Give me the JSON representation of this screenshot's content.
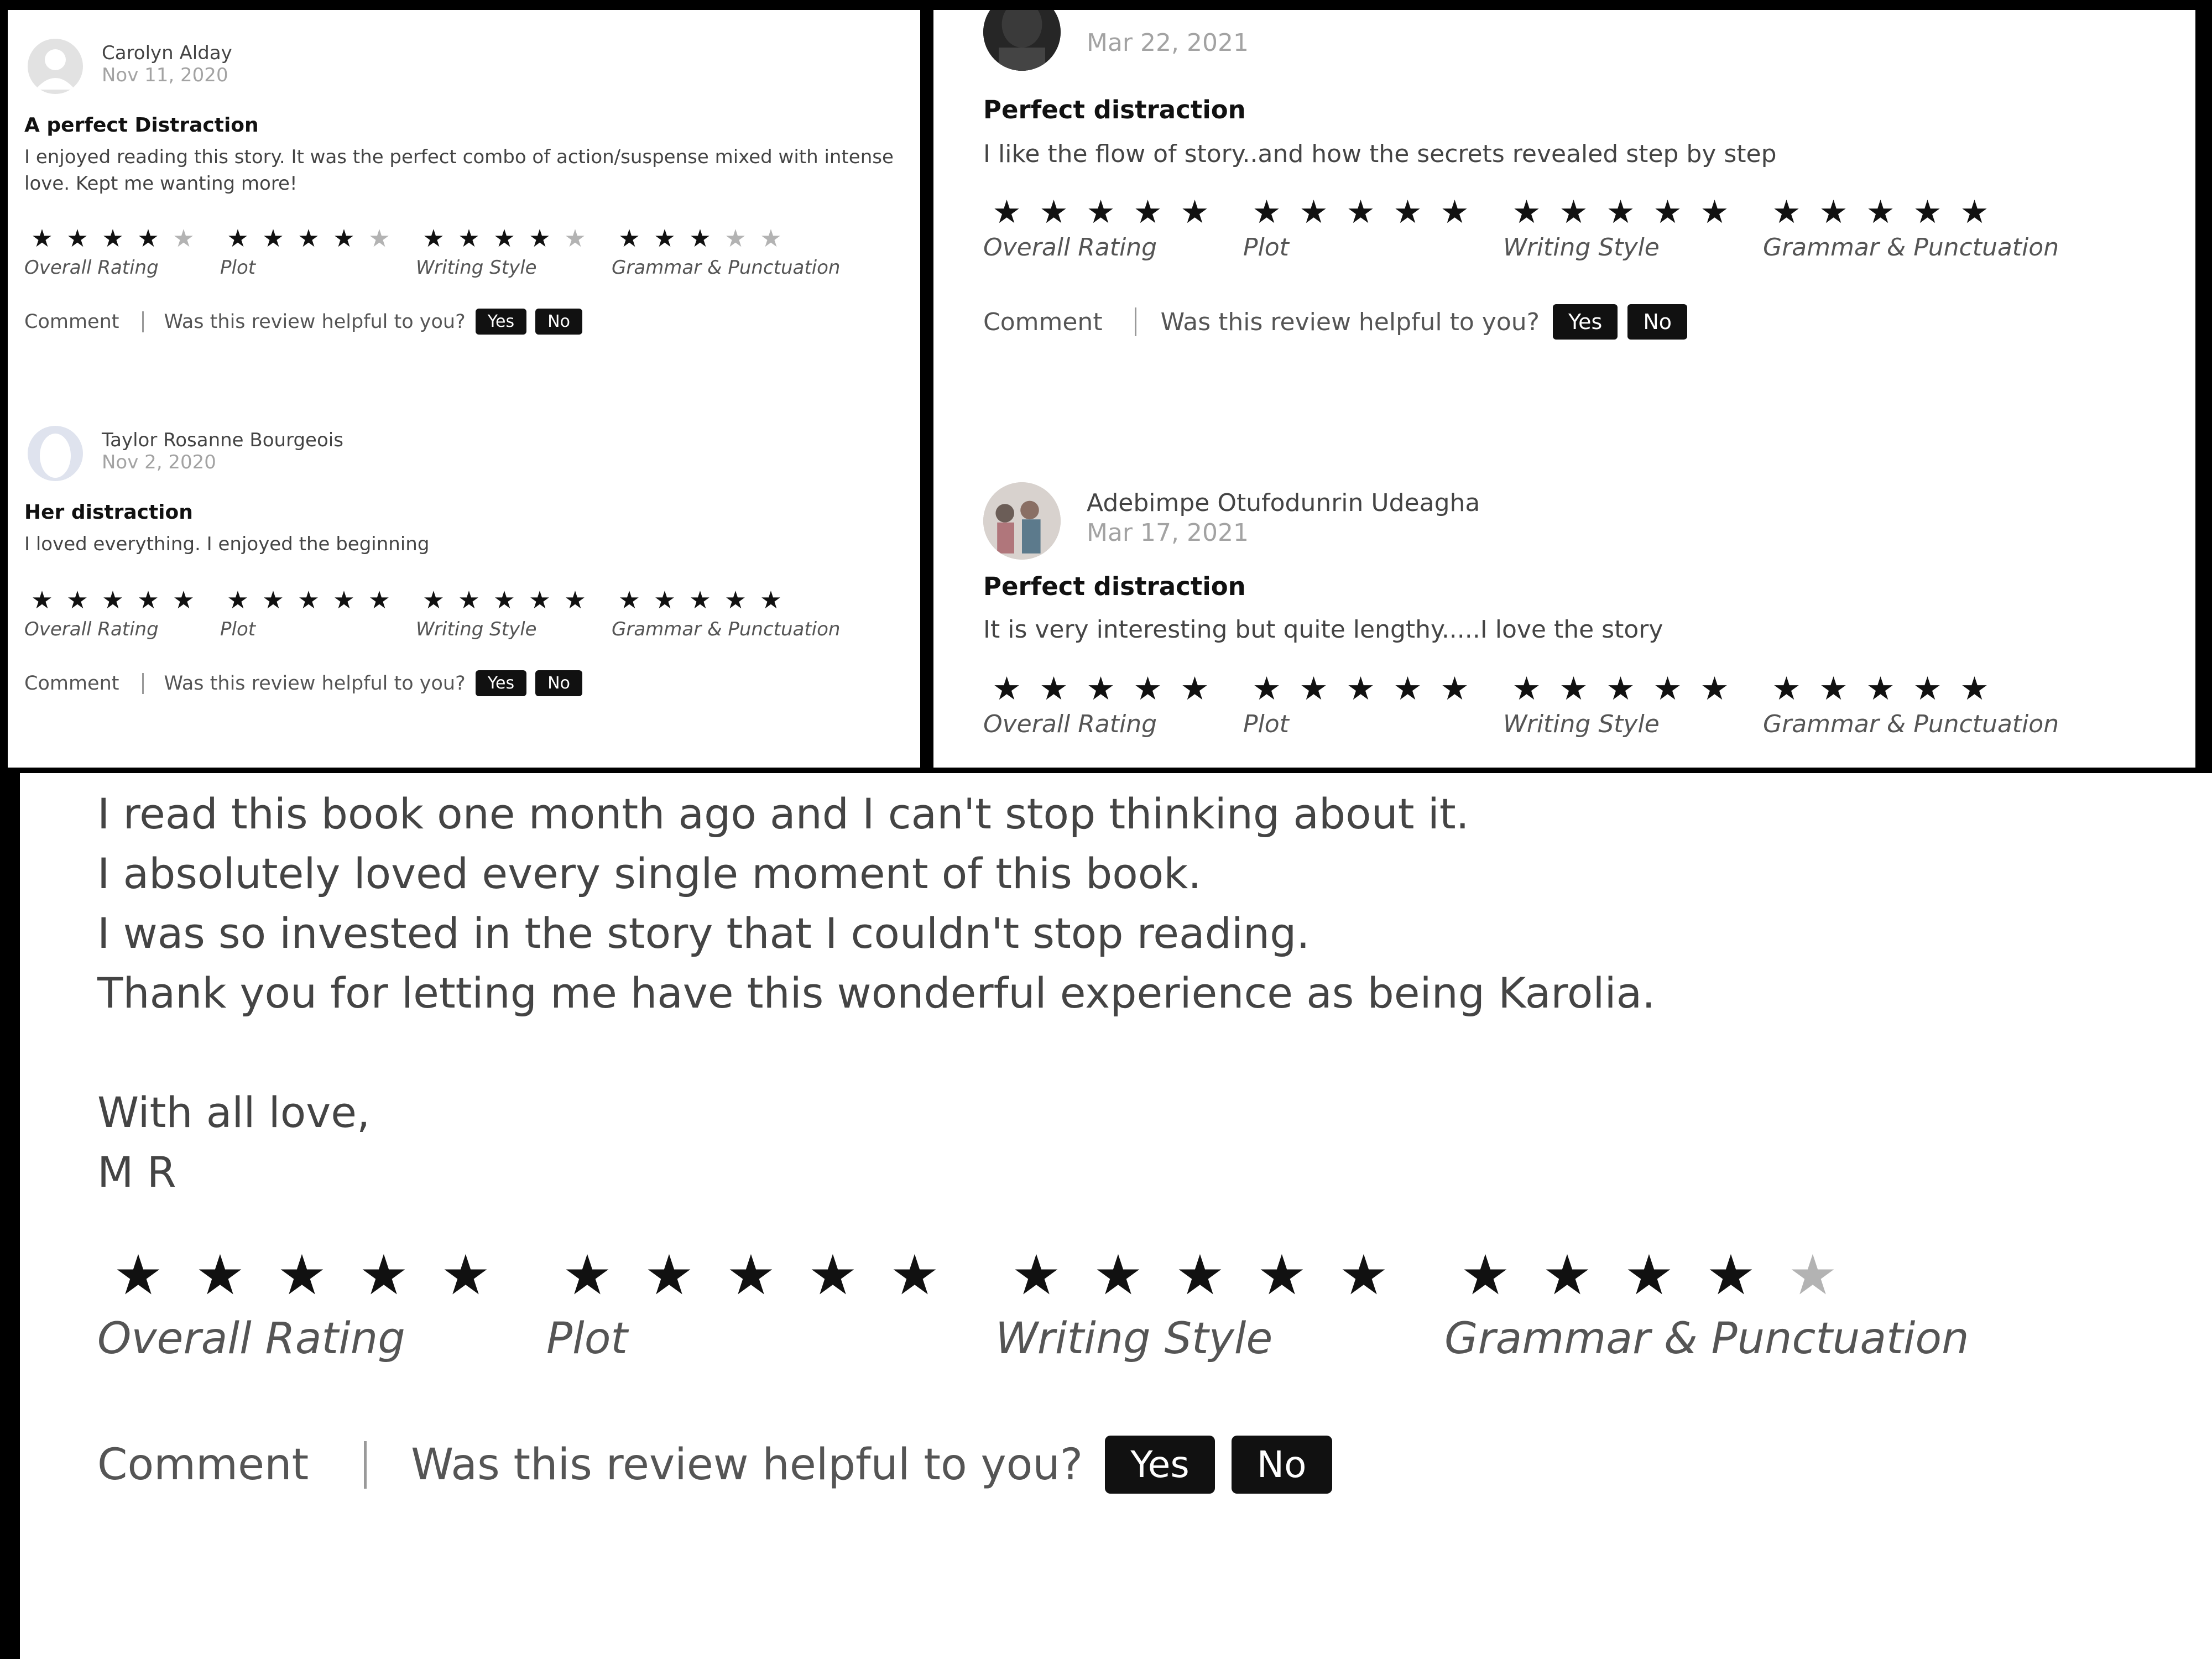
{
  "panel_left": {
    "reviews": [
      {
        "author": "Carolyn Alday",
        "date": "Nov 11, 2020",
        "title": "A perfect Distraction",
        "body": "I enjoyed reading this story. It was the perfect combo of action/suspense mixed with intense love. Kept me wanting more!",
        "ratings": [
          {
            "label": "Overall Rating",
            "stars": 4
          },
          {
            "label": "Plot",
            "stars": 4
          },
          {
            "label": "Writing Style",
            "stars": 4
          },
          {
            "label": "Grammar & Punctuation",
            "stars": 3
          }
        ],
        "comment_label": "Comment",
        "helpful_question": "Was this review helpful to you?",
        "yes_label": "Yes",
        "no_label": "No"
      },
      {
        "author": "Taylor Rosanne Bourgeois",
        "date": "Nov 2, 2020",
        "title": "Her distraction",
        "body": "I loved everything. I enjoyed the beginning",
        "ratings": [
          {
            "label": "Overall Rating",
            "stars": 5
          },
          {
            "label": "Plot",
            "stars": 5
          },
          {
            "label": "Writing Style",
            "stars": 5
          },
          {
            "label": "Grammar & Punctuation",
            "stars": 5
          }
        ],
        "comment_label": "Comment",
        "helpful_question": "Was this review helpful to you?",
        "yes_label": "Yes",
        "no_label": "No"
      }
    ]
  },
  "panel_right": {
    "reviews": [
      {
        "date": "Mar 22, 2021",
        "title": "Perfect distraction",
        "body": "I like the flow of story..and how the secrets revealed step by step",
        "ratings": [
          {
            "label": "Overall Rating",
            "stars": 5
          },
          {
            "label": "Plot",
            "stars": 5
          },
          {
            "label": "Writing Style",
            "stars": 5
          },
          {
            "label": "Grammar & Punctuation",
            "stars": 5
          }
        ],
        "comment_label": "Comment",
        "helpful_question": "Was this review helpful to you?",
        "yes_label": "Yes",
        "no_label": "No"
      },
      {
        "author": "Adebimpe Otufodunrin Udeagha",
        "date": "Mar 17, 2021",
        "title": "Perfect distraction",
        "body": "It is very interesting but quite lengthy.....I love the story",
        "ratings": [
          {
            "label": "Overall Rating",
            "stars": 5
          },
          {
            "label": "Plot",
            "stars": 5
          },
          {
            "label": "Writing Style",
            "stars": 5
          },
          {
            "label": "Grammar & Punctuation",
            "stars": 5
          }
        ]
      }
    ]
  },
  "panel_bottom": {
    "body_lines": [
      "I read this book one month ago and I can't stop thinking about it.",
      "I absolutely loved every single moment of this book.",
      "I was so invested in the story that I couldn't stop reading.",
      "Thank you for letting me have this wonderful experience as being Karolia.",
      "",
      "With all love,",
      "M R"
    ],
    "ratings": [
      {
        "label": "Overall Rating",
        "stars": 5
      },
      {
        "label": "Plot",
        "stars": 5
      },
      {
        "label": "Writing Style",
        "stars": 5
      },
      {
        "label": "Grammar & Punctuation",
        "stars": 4
      }
    ],
    "comment_label": "Comment",
    "helpful_question": "Was this review helpful to you?",
    "yes_label": "Yes",
    "no_label": "No"
  },
  "icons": {
    "star": "star-icon",
    "avatar_placeholder": "user-avatar-icon"
  },
  "colors": {
    "star_filled": "#111111",
    "star_empty": "#b3b3b3",
    "button_bg": "#111111",
    "date_text": "#a3a3a3"
  }
}
